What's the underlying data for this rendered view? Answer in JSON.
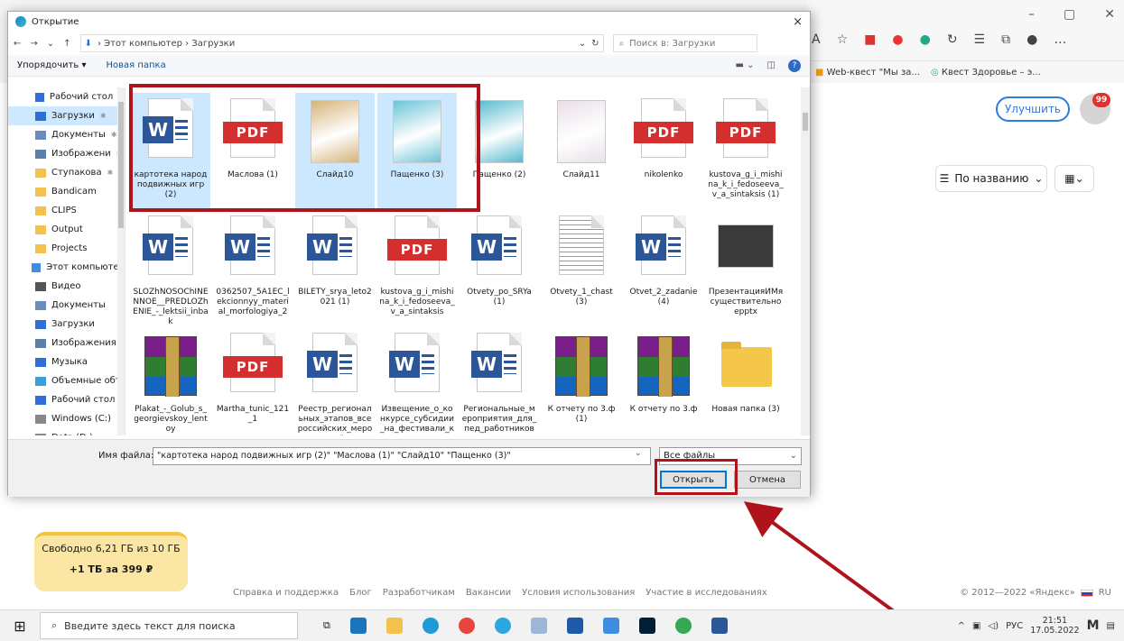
{
  "dialog": {
    "title": "Открытие",
    "close_glyph": "×",
    "address_path": "› Этот компьютер › Загрузки",
    "search_placeholder": "Поиск в: Загрузки",
    "toolbar": {
      "organize": "Упорядочить ▾",
      "new_folder": "Новая папка"
    },
    "nav_items": [
      {
        "label": "Рабочий стол",
        "icon": "desktop-icon",
        "color": "#2f6fd4",
        "pinned": true
      },
      {
        "label": "Загрузки",
        "icon": "download-icon",
        "color": "#2f6fd4",
        "pinned": true,
        "selected": true
      },
      {
        "label": "Документы",
        "icon": "documents-icon",
        "color": "#6a8bbf",
        "pinned": true
      },
      {
        "label": "Изображени",
        "icon": "pictures-icon",
        "color": "#5b7fa8",
        "pinned": true
      },
      {
        "label": "Ступакова",
        "icon": "folder-icon",
        "color": "#f2c14e",
        "pinned": true
      },
      {
        "label": "Bandicam",
        "icon": "folder-icon",
        "color": "#f2c14e"
      },
      {
        "label": "CLIPS",
        "icon": "folder-icon",
        "color": "#f2c14e"
      },
      {
        "label": "Output",
        "icon": "folder-icon",
        "color": "#f2c14e"
      },
      {
        "label": "Projects",
        "icon": "folder-icon",
        "color": "#f2c14e"
      },
      {
        "label": "Этот компьютер",
        "icon": "computer-icon",
        "color": "#3d8de0",
        "root": true
      },
      {
        "label": "Видео",
        "icon": "video-icon",
        "color": "#555"
      },
      {
        "label": "Документы",
        "icon": "documents-icon",
        "color": "#6a8bbf"
      },
      {
        "label": "Загрузки",
        "icon": "download-icon",
        "color": "#2f6fd4"
      },
      {
        "label": "Изображения",
        "icon": "pictures-icon",
        "color": "#5b7fa8"
      },
      {
        "label": "Музыка",
        "icon": "music-icon",
        "color": "#2f6fd4"
      },
      {
        "label": "Объемные объ",
        "icon": "3d-objects-icon",
        "color": "#3aa0d8"
      },
      {
        "label": "Рабочий стол",
        "icon": "desktop-icon",
        "color": "#2f6fd4"
      },
      {
        "label": "Windows (C:)",
        "icon": "drive-icon",
        "color": "#888"
      },
      {
        "label": "Data (D:)",
        "icon": "drive-icon",
        "color": "#888"
      }
    ],
    "files": [
      {
        "name": "картотека народ подвижных игр (2)",
        "type": "word",
        "selected": true
      },
      {
        "name": "Маслова (1)",
        "type": "pdf"
      },
      {
        "name": "Слайд10",
        "type": "image",
        "color": "#d6b37a",
        "selected": true
      },
      {
        "name": "Пащенко (3)",
        "type": "image",
        "color": "#6dc4d8",
        "selected": true
      },
      {
        "name": "Пащенко (2)",
        "type": "image",
        "color": "#57b9cf"
      },
      {
        "name": "Слайд11",
        "type": "image",
        "color": "#e9dfe8"
      },
      {
        "name": "nikolenko",
        "type": "pdf"
      },
      {
        "name": "kustova_g_i_mishina_k_i_fedoseeva_v_a_sintaksis (1)",
        "type": "pdf"
      },
      {
        "name": "SLOZhNOSOChINENNOE__PREDLOZhENIE_-_lektsii_inbak",
        "type": "word"
      },
      {
        "name": "0362507_5A1EC_lekcionnyy_material_morfologiya_2",
        "type": "word2"
      },
      {
        "name": "BILETY_srya_leto2021 (1)",
        "type": "word"
      },
      {
        "name": "kustova_g_i_mishina_k_i_fedoseeva_v_a_sintaksis",
        "type": "pdf"
      },
      {
        "name": "Otvety_po_SRYa (1)",
        "type": "word2"
      },
      {
        "name": "Otvety_1_chast (3)",
        "type": "doc"
      },
      {
        "name": "Otvet_2_zadanie (4)",
        "type": "word"
      },
      {
        "name": "ПрезентацияИМя существительноepptx",
        "type": "ppt"
      },
      {
        "name": "Plakat_-_Golub_s_georgievskoy_lentoy",
        "type": "rar"
      },
      {
        "name": "Martha_tunic_121_1",
        "type": "pdf"
      },
      {
        "name": "Реестр_региональных_этапов_всероссийских_мероприятий_н...",
        "type": "word"
      },
      {
        "name": "Извещение_о_конкурсе_субсидии_на_фестивали_конкурсы_пр...",
        "type": "word"
      },
      {
        "name": "Региональные_мероприятия_для_пед_работников",
        "type": "word"
      },
      {
        "name": "К отчету по 3.ф (1)",
        "type": "rar"
      },
      {
        "name": "К отчету по 3.ф",
        "type": "rar"
      },
      {
        "name": "Новая папка (3)",
        "type": "folder"
      }
    ],
    "filename_label": "Имя файла:",
    "filename_value": "\"картотека народ подвижных игр (2)\" \"Маслова (1)\" \"Слайд10\" \"Пащенко (3)\"",
    "filetype_value": "Все файлы",
    "open_label": "Открыть",
    "cancel_label": "Отмена"
  },
  "browser": {
    "bookmarks": [
      "Web-квест \"Мы за...",
      "Квест Здоровье – э..."
    ]
  },
  "page": {
    "upgrade_label": "Улучшить",
    "badge_count": "99",
    "sort_label": "По названию",
    "storage_free": "Свободно 6,21 ГБ из 10 ГБ",
    "storage_buy": "+1 ТБ за 399 ₽",
    "footer_links": [
      "Справка и поддержка",
      "Блог",
      "Разработчикам",
      "Вакансии",
      "Условия использования",
      "Участие в исследованиях"
    ],
    "copyright": "© 2012—2022 «Яндекс»",
    "lang": "RU"
  },
  "taskbar": {
    "search_placeholder": "Введите здесь текст для поиска",
    "lang": "РУС",
    "time": "21:51",
    "date": "17.05.2022"
  },
  "colors": {
    "annotation": "#b0141b",
    "selection": "#cce8ff",
    "accent": "#0078d7"
  }
}
